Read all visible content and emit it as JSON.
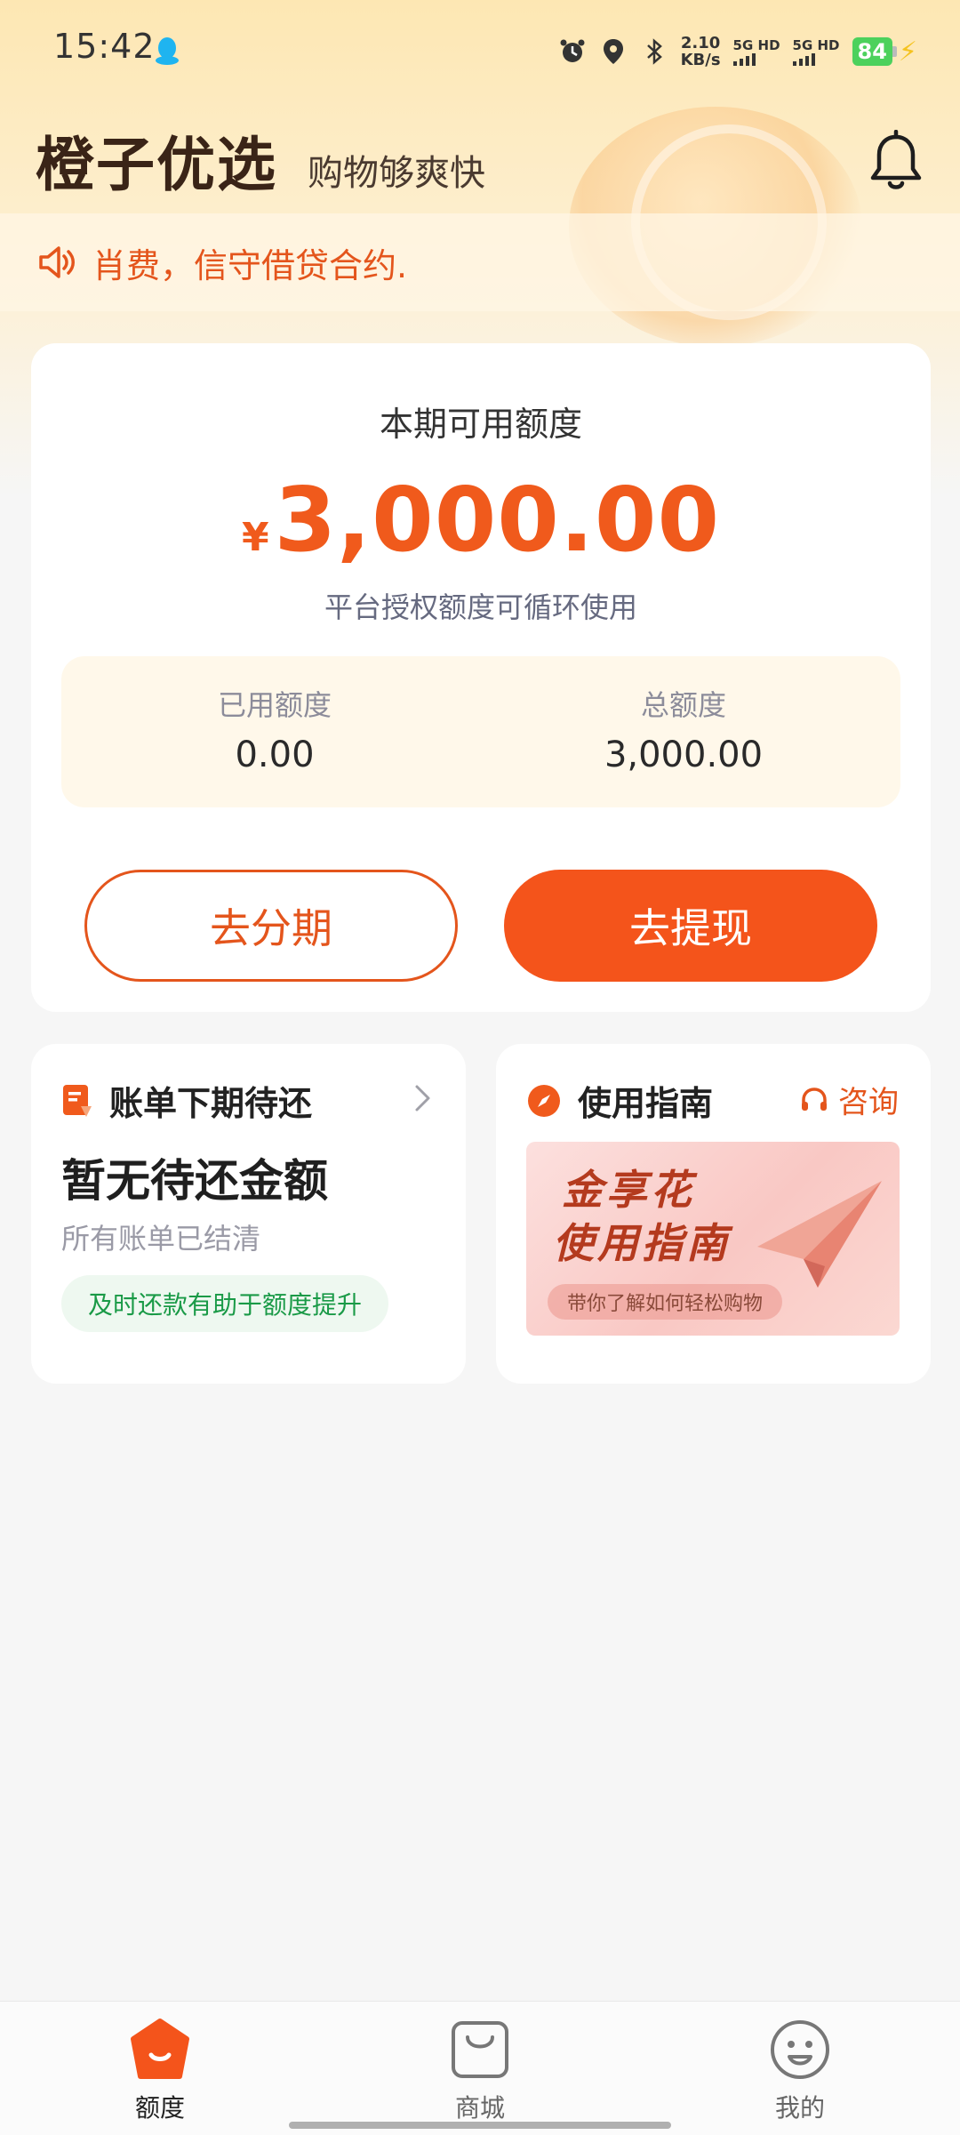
{
  "status_bar": {
    "time": "15:42",
    "net_speed_value": "2.10",
    "net_speed_unit": "KB/s",
    "sim1": "5G HD",
    "sim2": "5G HD",
    "battery": "84"
  },
  "header": {
    "brand": "橙子优选",
    "slogan": "购物够爽快"
  },
  "notice": {
    "text": "肖费，信守借贷合约."
  },
  "credit": {
    "label": "本期可用额度",
    "currency": "¥",
    "amount": "3,000.00",
    "description": "平台授权额度可循环使用",
    "used_label": "已用额度",
    "used_value": "0.00",
    "total_label": "总额度",
    "total_value": "3,000.00",
    "installment_button": "去分期",
    "withdraw_button": "去提现"
  },
  "bill_card": {
    "title": "账单下期待还",
    "main": "暂无待还金额",
    "sub": "所有账单已结清",
    "tip": "及时还款有助于额度提升"
  },
  "guide_card": {
    "title": "使用指南",
    "consult": "咨询",
    "banner_line1": "金享花",
    "banner_line2": "使用指南",
    "banner_pill": "带你了解如何轻松购物"
  },
  "bottom_nav": {
    "items": [
      {
        "label": "额度",
        "icon": "quota-icon",
        "active": true
      },
      {
        "label": "商城",
        "icon": "shopping-bag-icon",
        "active": false
      },
      {
        "label": "我的",
        "icon": "smiley-face-icon",
        "active": false
      }
    ]
  },
  "colors": {
    "accent": "#f4541b",
    "success": "#1a9a47"
  }
}
